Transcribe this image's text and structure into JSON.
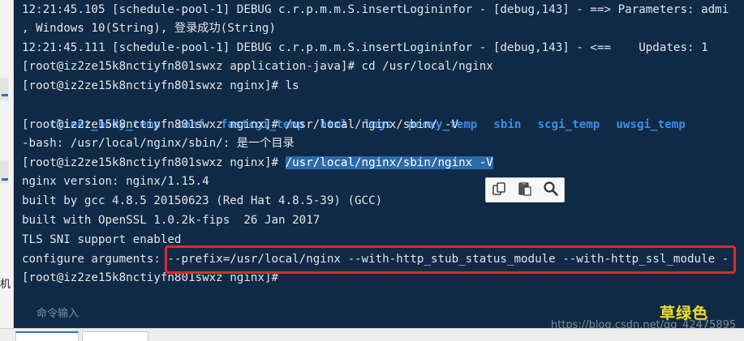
{
  "terminal": {
    "lines": [
      "12:21:45.105 [schedule-pool-1] DEBUG c.r.p.m.m.S.insertLogininfor - [debug,143] - ==> Parameters: admi",
      ", Windows 10(String), 登录成功(String)",
      "12:21:45.111 [schedule-pool-1] DEBUG c.r.p.m.m.S.insertLogininfor - [debug,143] - <==    Updates: 1",
      "[root@iz2ze15k8nctiyfn801swxz application-java]# cd /usr/local/nginx",
      "[root@iz2ze15k8nctiyfn801swxz nginx]# ls",
      "",
      "[root@iz2ze15k8nctiyfn801swxz nginx]# /usr/local/nginx/sbin/ -V",
      "-bash: /usr/local/nginx/sbin/: 是一个目录",
      "",
      "nginx version: nginx/1.15.4",
      "built by gcc 4.8.5 20150623 (Red Hat 4.8.5-39) (GCC)",
      "built with OpenSSL 1.0.2k-fips  26 Jan 2017",
      "TLS SNI support enabled",
      "configure arguments: --prefix=/usr/local/nginx --with-http_stub_status_module --with-http_ssl_module -",
      "[root@iz2ze15k8nctiyfn801swxz nginx]#"
    ],
    "ls_items": [
      "client_body_temp",
      "conf",
      "fastcgi_temp",
      "html",
      "logs",
      "proxy_temp",
      "sbin",
      "scgi_temp",
      "uwsgi_temp"
    ],
    "selected_prompt": "[root@iz2ze15k8nctiyfn801swxz nginx]# ",
    "selected_command": "/usr/local/nginx/sbin/nginx -V"
  },
  "command_input": {
    "placeholder": "命令输入"
  },
  "left_strip": {
    "fragment": "机"
  },
  "watermark": {
    "brand": "草绿色",
    "url": "https://blog.csdn.net/qq_42475895"
  },
  "colors": {
    "terminal_bg": "#0f2a46",
    "ls_dir": "#3b8fe8",
    "highlight": "#e02a2a",
    "selection": "#2c6aa8"
  },
  "icons": [
    "copy-icon",
    "paste-icon",
    "search-icon"
  ]
}
